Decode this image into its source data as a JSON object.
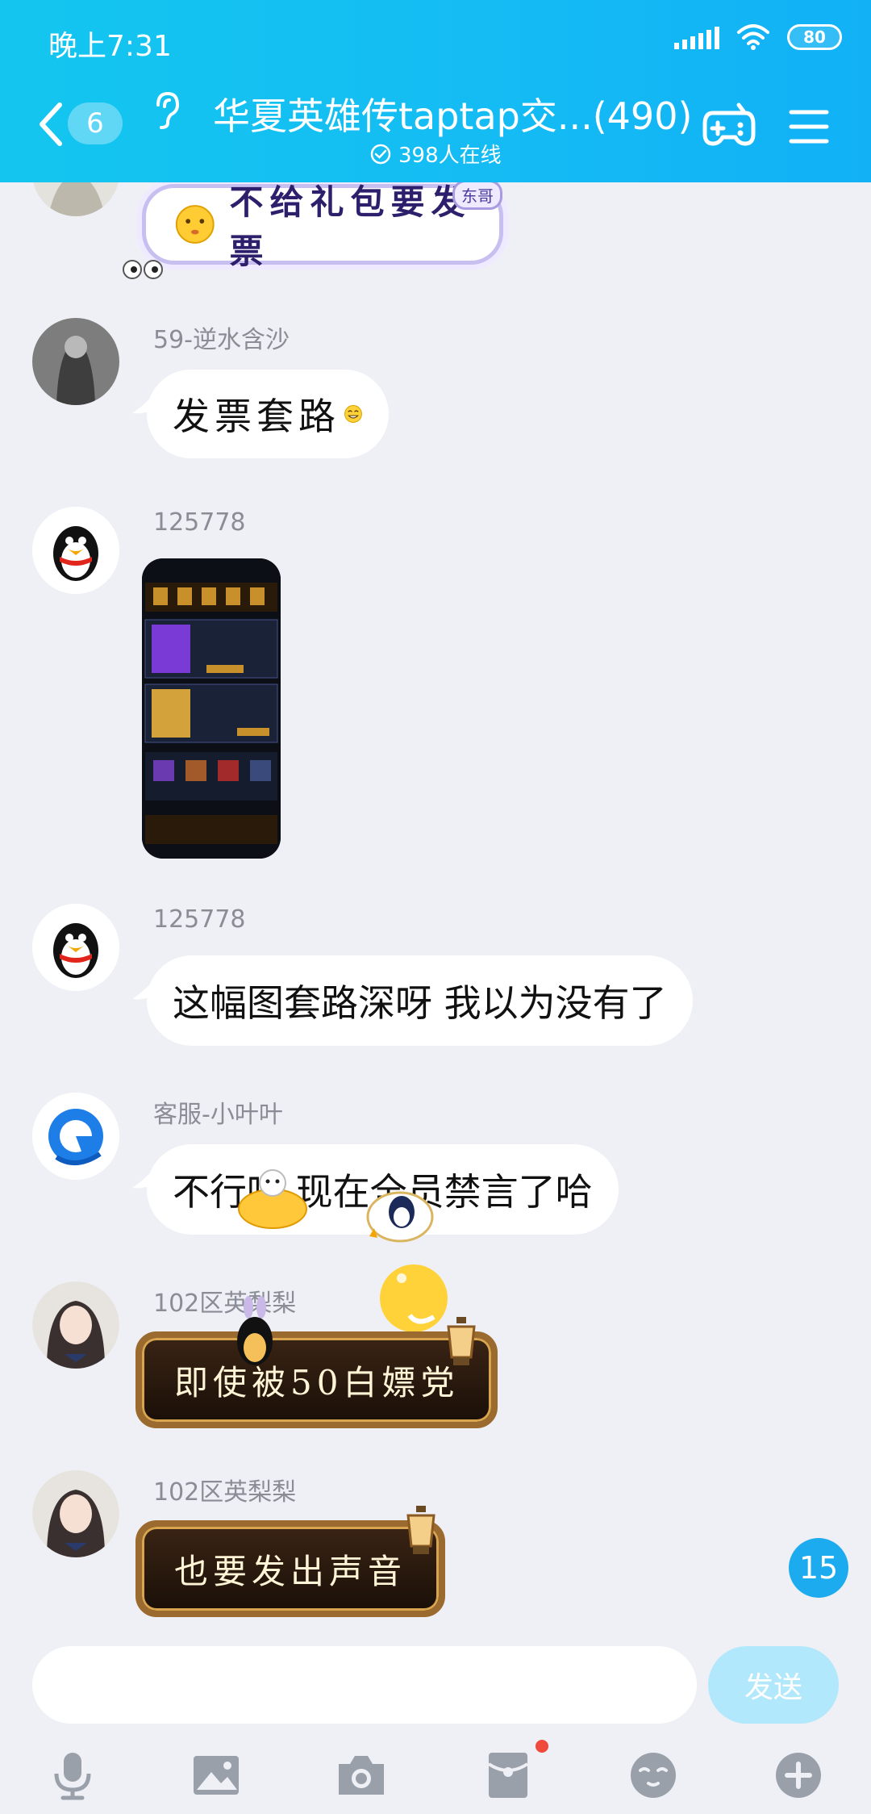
{
  "status_bar": {
    "time": "晚上7:31",
    "battery": "80",
    "icons": [
      "signal-icon",
      "wifi-icon",
      "battery-icon"
    ]
  },
  "header": {
    "back_icon": "chevron-left-icon",
    "unread_count": "6",
    "ear_icon": "ear-icon",
    "title": "华夏英雄传taptap交...",
    "member_count": "(490)",
    "online_icon": "check-circle-icon",
    "online_text": "398人在线",
    "game_icon": "gamepad-icon",
    "menu_icon": "menu-icon"
  },
  "messages": [
    {
      "sender": "",
      "text": "不给礼包要发票",
      "tag": "东哥",
      "style": "purple-sticker-bubble"
    },
    {
      "sender": "59-逆水含沙",
      "text": "发票套路",
      "emoji": "grin-emoji",
      "style": "calligraphy"
    },
    {
      "sender": "125778",
      "type": "image",
      "image_desc": "game-screenshot"
    },
    {
      "sender": "125778",
      "text": "这幅图套路深呀 我以为没有了"
    },
    {
      "sender": "客服-小叶叶",
      "text": "不行呢 现在全员禁言了哈"
    },
    {
      "sender": "102区英梨梨",
      "text": "即使被50白嫖党",
      "style": "gold-bubble"
    },
    {
      "sender": "102区英梨梨",
      "text": "也要发出声音",
      "style": "gold-bubble"
    }
  ],
  "new_message_badge": "15",
  "input": {
    "value": "",
    "placeholder": "",
    "send_label": "发送"
  },
  "toolbar": [
    "microphone-icon",
    "image-icon",
    "camera-icon",
    "red-packet-icon",
    "emoji-icon",
    "plus-icon"
  ],
  "colors": {
    "header": "#14bdf3",
    "background": "#eef0f6",
    "badge": "#1cabee",
    "send_disabled": "#b2e8fb",
    "notification_dot": "#f04a3c"
  }
}
